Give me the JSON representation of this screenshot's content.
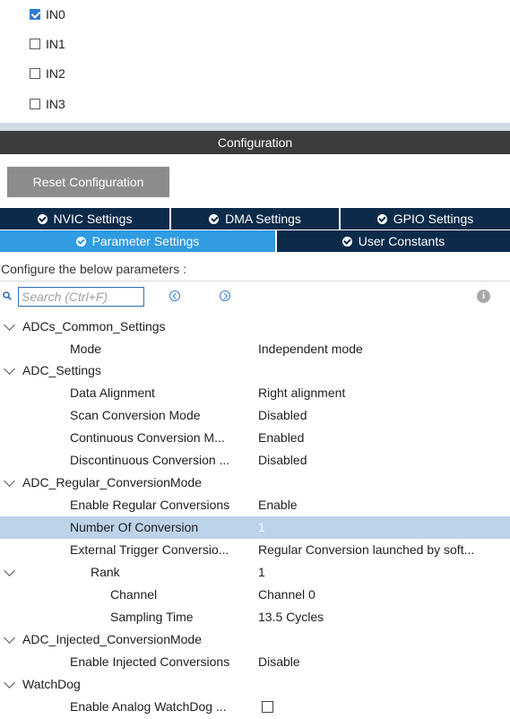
{
  "channels": [
    {
      "label": "IN0",
      "checked": true
    },
    {
      "label": "IN1",
      "checked": false
    },
    {
      "label": "IN2",
      "checked": false
    },
    {
      "label": "IN3",
      "checked": false
    }
  ],
  "configuration": {
    "header": "Configuration",
    "reset_button": "Reset Configuration"
  },
  "tabs": {
    "row1": [
      "NVIC Settings",
      "DMA Settings",
      "GPIO Settings"
    ],
    "row2": [
      "Parameter Settings",
      "User Constants"
    ],
    "active": "Parameter Settings"
  },
  "params": {
    "description": "Configure the below parameters :",
    "search_placeholder": "Search (Ctrl+F)",
    "rows": [
      {
        "type": "group",
        "label": "ADCs_Common_Settings"
      },
      {
        "type": "param",
        "label": "Mode",
        "value": "Independent mode"
      },
      {
        "type": "group",
        "label": "ADC_Settings"
      },
      {
        "type": "param",
        "label": "Data Alignment",
        "value": "Right alignment"
      },
      {
        "type": "param",
        "label": "Scan Conversion Mode",
        "value": "Disabled"
      },
      {
        "type": "param",
        "label": "Continuous Conversion M...",
        "value": "Enabled"
      },
      {
        "type": "param",
        "label": "Discontinuous Conversion ...",
        "value": "Disabled"
      },
      {
        "type": "group",
        "label": "ADC_Regular_ConversionMode"
      },
      {
        "type": "param",
        "label": "Enable Regular Conversions",
        "value": "Enable"
      },
      {
        "type": "param",
        "label": "Number Of Conversion",
        "value": "1",
        "selected": true
      },
      {
        "type": "param",
        "label": "External Trigger Conversio...",
        "value": "Regular Conversion launched by soft..."
      },
      {
        "type": "subgroup",
        "label": "Rank",
        "value": "1"
      },
      {
        "type": "subparam",
        "label": "Channel",
        "value": "Channel 0"
      },
      {
        "type": "subparam",
        "label": "Sampling Time",
        "value": "13.5 Cycles"
      },
      {
        "type": "group",
        "label": "ADC_Injected_ConversionMode"
      },
      {
        "type": "param",
        "label": "Enable Injected Conversions",
        "value": "Disable"
      },
      {
        "type": "group",
        "label": "WatchDog"
      },
      {
        "type": "param",
        "label": "Enable Analog WatchDog ...",
        "checkbox": true,
        "checked": false
      }
    ]
  },
  "colors": {
    "accent_blue": "#2f9be0",
    "dark_navy": "#0c2a4a",
    "selected_row": "#bcd3ea",
    "header_dark": "#3c3c3c",
    "button_gray": "#8c8c8c"
  }
}
